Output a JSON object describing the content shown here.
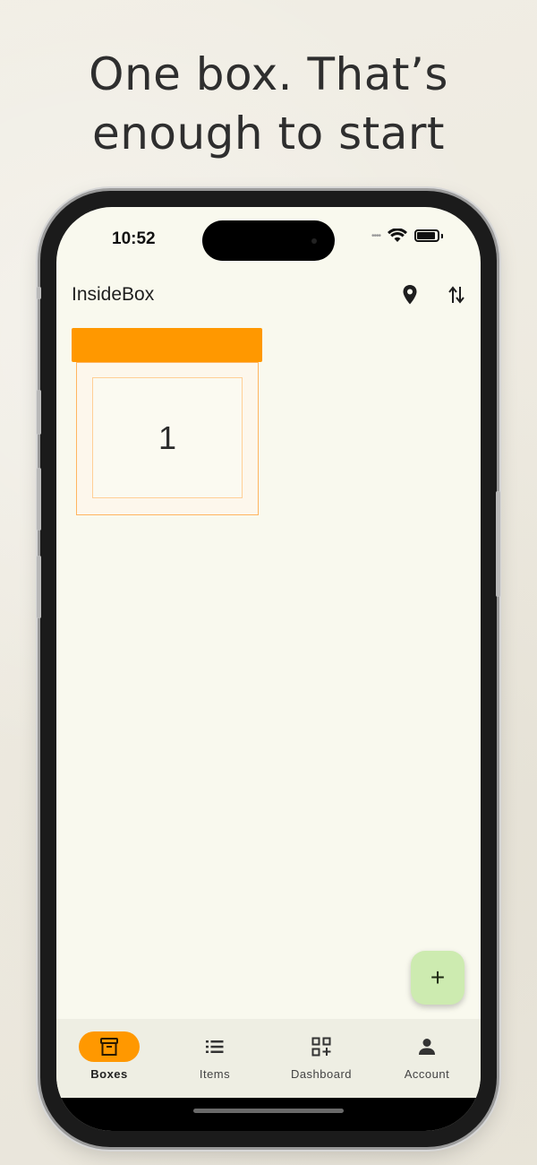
{
  "promo": {
    "headline_line1": "One box. That’s",
    "headline_line2": "enough to start"
  },
  "status_bar": {
    "time": "10:52",
    "signal": "••••"
  },
  "app_bar": {
    "title": "InsideBox",
    "icons": [
      "location-pin-icon",
      "sort-icon"
    ]
  },
  "boxes": [
    {
      "number": "1",
      "color": "#ff9800"
    }
  ],
  "fab": {
    "icon": "add-icon",
    "symbol": "+"
  },
  "bottom_nav": {
    "items": [
      {
        "label": "Boxes",
        "icon": "archive-box-icon",
        "active": true
      },
      {
        "label": "Items",
        "icon": "list-icon",
        "active": false
      },
      {
        "label": "Dashboard",
        "icon": "qr-add-icon",
        "active": false
      },
      {
        "label": "Account",
        "icon": "person-icon",
        "active": false
      }
    ]
  },
  "colors": {
    "accent": "#ff9800",
    "fab": "#cdebb0",
    "screen_bg": "#f9f9ee",
    "nav_bg": "#eeeee3"
  }
}
